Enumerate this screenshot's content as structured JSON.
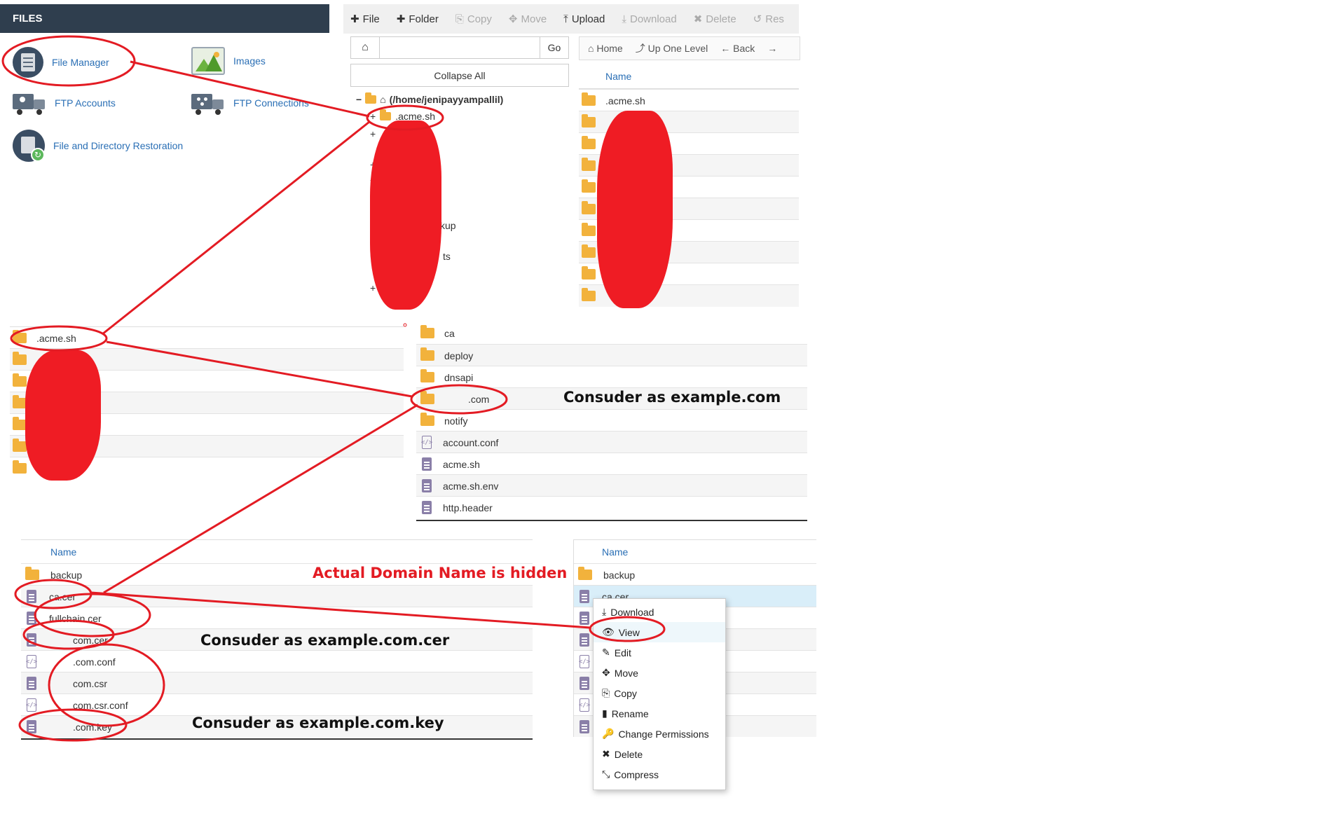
{
  "files_panel": {
    "header": "FILES",
    "items": [
      {
        "label": "File Manager",
        "icon": "file-cabinet-icon"
      },
      {
        "label": "Images",
        "icon": "picture-icon"
      },
      {
        "label": "FTP Accounts",
        "icon": "ftp-truck-user-icon"
      },
      {
        "label": "FTP Connections",
        "icon": "ftp-truck-network-icon"
      },
      {
        "label": "File and Directory Restoration",
        "icon": "restore-icon"
      }
    ]
  },
  "toolbar": {
    "buttons": [
      {
        "label": "File",
        "symbol": "✚",
        "enabled": true
      },
      {
        "label": "Folder",
        "symbol": "✚",
        "enabled": true
      },
      {
        "label": "Copy",
        "symbol": "⎘",
        "enabled": false
      },
      {
        "label": "Move",
        "symbol": "✥",
        "enabled": false
      },
      {
        "label": "Upload",
        "symbol": "⤒",
        "enabled": true
      },
      {
        "label": "Download",
        "symbol": "⤓",
        "enabled": false
      },
      {
        "label": "Delete",
        "symbol": "✖",
        "enabled": false
      },
      {
        "label": "Res",
        "symbol": "↺",
        "enabled": false
      }
    ]
  },
  "tree": {
    "go_label": "Go",
    "collapse_label": "Collapse All",
    "root": "(/home/jenipayyampallil)",
    "first_child": ".acme.sh",
    "partial_labels": [
      "kup",
      "ts"
    ]
  },
  "nav": {
    "home": "Home",
    "up": "Up One Level",
    "back": "Back",
    "name_header": "Name",
    "first_item": ".acme.sh"
  },
  "acme_panel": {
    "first_item": ".acme.sh"
  },
  "acme_contents": {
    "items": [
      {
        "name": "ca",
        "type": "folder"
      },
      {
        "name": "deploy",
        "type": "folder"
      },
      {
        "name": "dnsapi",
        "type": "folder"
      },
      {
        "name": ".com",
        "type": "folder"
      },
      {
        "name": "notify",
        "type": "folder"
      },
      {
        "name": "account.conf",
        "type": "code"
      },
      {
        "name": "acme.sh",
        "type": "file"
      },
      {
        "name": "acme.sh.env",
        "type": "file"
      },
      {
        "name": "http.header",
        "type": "file"
      }
    ]
  },
  "domain_panel": {
    "name_header": "Name",
    "items": [
      {
        "name": "backup",
        "type": "folder"
      },
      {
        "name": "ca.cer",
        "type": "file"
      },
      {
        "name": "fullchain.cer",
        "type": "file"
      },
      {
        "name": "com.cer",
        "type": "file"
      },
      {
        "name": ".com.conf",
        "type": "code"
      },
      {
        "name": "com.csr",
        "type": "file"
      },
      {
        "name": "com.csr.conf",
        "type": "code"
      },
      {
        "name": ".com.key",
        "type": "file"
      }
    ]
  },
  "right_panel": {
    "name_header": "Name",
    "items": [
      {
        "name": "backup",
        "type": "folder"
      },
      {
        "name": "ca.cer",
        "type": "file"
      }
    ]
  },
  "context_menu": {
    "items": [
      {
        "label": "Download",
        "symbol": "⤓"
      },
      {
        "label": "View",
        "symbol": "👁"
      },
      {
        "label": "Edit",
        "symbol": "✎"
      },
      {
        "label": "Move",
        "symbol": "✥"
      },
      {
        "label": "Copy",
        "symbol": "⎘"
      },
      {
        "label": "Rename",
        "symbol": "▮"
      },
      {
        "label": "Change Permissions",
        "symbol": "🔑"
      },
      {
        "label": "Delete",
        "symbol": "✖"
      },
      {
        "label": "Compress",
        "symbol": "⤡"
      }
    ]
  },
  "annotations": {
    "consider_example_com": "Consuder as example.com",
    "domain_hidden": "Actual Domain Name is hidden",
    "consider_cer": "Consuder as example.com.cer",
    "consider_key": "Consuder as example.com.key"
  },
  "colors": {
    "header_bg": "#2f3e4e",
    "link": "#2a6fb5",
    "folder": "#f2b23c",
    "annotation_red": "#e31b23",
    "selected_row": "#d9eef9"
  }
}
